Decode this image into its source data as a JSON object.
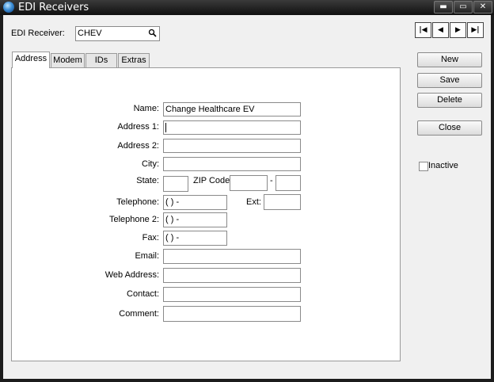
{
  "window": {
    "title": "EDI Receivers",
    "min_label": "▬",
    "max_label": "▭",
    "close_label": "✕"
  },
  "receiver": {
    "label": "EDI Receiver:",
    "value": "CHEV"
  },
  "nav": {
    "first": "|◀",
    "prev": "◀",
    "next": "▶",
    "last": "▶|"
  },
  "tabs": [
    "Address",
    "Modem",
    "IDs",
    "Extras"
  ],
  "buttons": {
    "new": "New",
    "save": "Save",
    "delete": "Delete",
    "close": "Close"
  },
  "inactive": {
    "label": "Inactive",
    "checked": false
  },
  "form": {
    "name": {
      "label": "Name:",
      "value": "Change Healthcare EV"
    },
    "address1": {
      "label": "Address 1:",
      "value": ""
    },
    "address2": {
      "label": "Address 2:",
      "value": ""
    },
    "city": {
      "label": "City:",
      "value": ""
    },
    "state": {
      "label": "State:",
      "value": ""
    },
    "zip": {
      "label": "ZIP Code:",
      "value": "",
      "sep": "-",
      "ext_value": ""
    },
    "telephone": {
      "label": "Telephone:",
      "value": "(  )    -"
    },
    "ext": {
      "label": "Ext:",
      "value": ""
    },
    "telephone2": {
      "label": "Telephone 2:",
      "value": "(  )    -"
    },
    "fax": {
      "label": "Fax:",
      "value": "(  )    -"
    },
    "email": {
      "label": "Email:",
      "value": ""
    },
    "web": {
      "label": "Web Address:",
      "value": ""
    },
    "contact": {
      "label": "Contact:",
      "value": ""
    },
    "comment": {
      "label": "Comment:",
      "value": ""
    }
  }
}
